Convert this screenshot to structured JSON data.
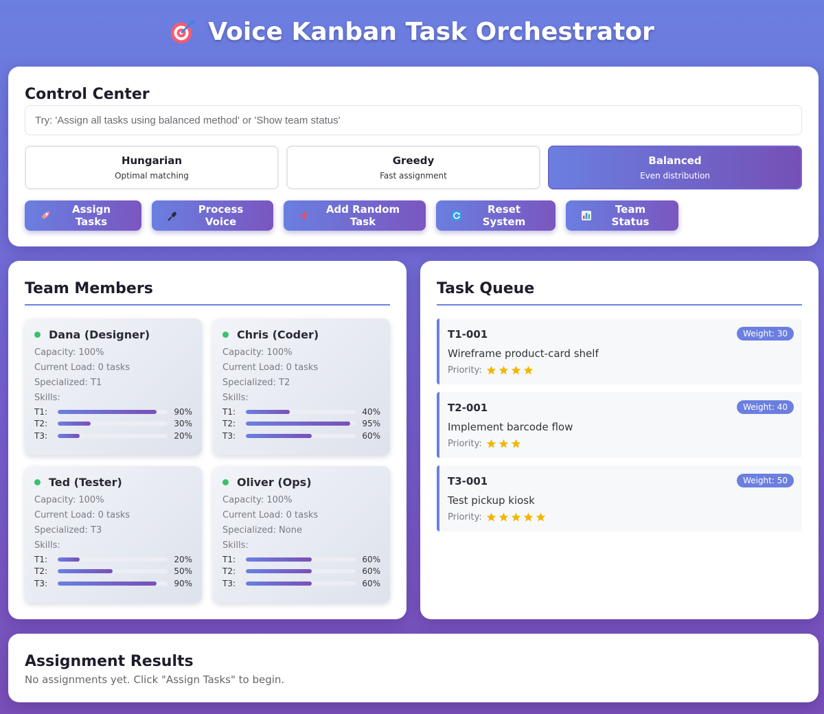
{
  "app": {
    "title": "Voice Kanban Task Orchestrator",
    "title_icon": "target-icon"
  },
  "colors": {
    "accent": "#6b7fe0",
    "accent_dark": "#7a4fb8",
    "online": "#3cbf6e",
    "star": "#f2b600"
  },
  "control": {
    "heading": "Control Center",
    "input_placeholder": "Try: 'Assign all tasks using balanced method' or 'Show team status'",
    "input_value": "",
    "methods": [
      {
        "name": "Hungarian",
        "desc": "Optimal matching",
        "active": false
      },
      {
        "name": "Greedy",
        "desc": "Fast assignment",
        "active": false
      },
      {
        "name": "Balanced",
        "desc": "Even distribution",
        "active": true
      }
    ],
    "actions": [
      {
        "label": "Assign Tasks",
        "icon": "rocket-icon"
      },
      {
        "label": "Process Voice",
        "icon": "microphone-icon"
      },
      {
        "label": "Add Random Task",
        "icon": "plus-icon"
      },
      {
        "label": "Reset System",
        "icon": "refresh-icon"
      },
      {
        "label": "Team Status",
        "icon": "bar-chart-icon"
      }
    ]
  },
  "team": {
    "heading": "Team Members",
    "members": [
      {
        "name": "Dana (Designer)",
        "capacity": "Capacity: 100%",
        "load": "Current Load: 0 tasks",
        "specialized": "Specialized: T1",
        "skills_label": "Skills:",
        "skills": [
          {
            "label": "T1:",
            "value": 90,
            "text": "90%"
          },
          {
            "label": "T2:",
            "value": 30,
            "text": "30%"
          },
          {
            "label": "T3:",
            "value": 20,
            "text": "20%"
          }
        ]
      },
      {
        "name": "Chris (Coder)",
        "capacity": "Capacity: 100%",
        "load": "Current Load: 0 tasks",
        "specialized": "Specialized: T2",
        "skills_label": "Skills:",
        "skills": [
          {
            "label": "T1:",
            "value": 40,
            "text": "40%"
          },
          {
            "label": "T2:",
            "value": 95,
            "text": "95%"
          },
          {
            "label": "T3:",
            "value": 60,
            "text": "60%"
          }
        ]
      },
      {
        "name": "Ted (Tester)",
        "capacity": "Capacity: 100%",
        "load": "Current Load: 0 tasks",
        "specialized": "Specialized: T3",
        "skills_label": "Skills:",
        "skills": [
          {
            "label": "T1:",
            "value": 20,
            "text": "20%"
          },
          {
            "label": "T2:",
            "value": 50,
            "text": "50%"
          },
          {
            "label": "T3:",
            "value": 90,
            "text": "90%"
          }
        ]
      },
      {
        "name": "Oliver (Ops)",
        "capacity": "Capacity: 100%",
        "load": "Current Load: 0 tasks",
        "specialized": "Specialized: None",
        "skills_label": "Skills:",
        "skills": [
          {
            "label": "T1:",
            "value": 60,
            "text": "60%"
          },
          {
            "label": "T2:",
            "value": 60,
            "text": "60%"
          },
          {
            "label": "T3:",
            "value": 60,
            "text": "60%"
          }
        ]
      }
    ]
  },
  "queue": {
    "heading": "Task Queue",
    "priority_label": "Priority:",
    "tasks": [
      {
        "id": "T1-001",
        "title": "Wireframe product-card shelf",
        "weight": "Weight: 30",
        "priority": 4
      },
      {
        "id": "T2-001",
        "title": "Implement barcode flow",
        "weight": "Weight: 40",
        "priority": 3
      },
      {
        "id": "T3-001",
        "title": "Test pickup kiosk",
        "weight": "Weight: 50",
        "priority": 5
      }
    ]
  },
  "results": {
    "heading": "Assignment Results",
    "empty_text": "No assignments yet. Click \"Assign Tasks\" to begin."
  }
}
